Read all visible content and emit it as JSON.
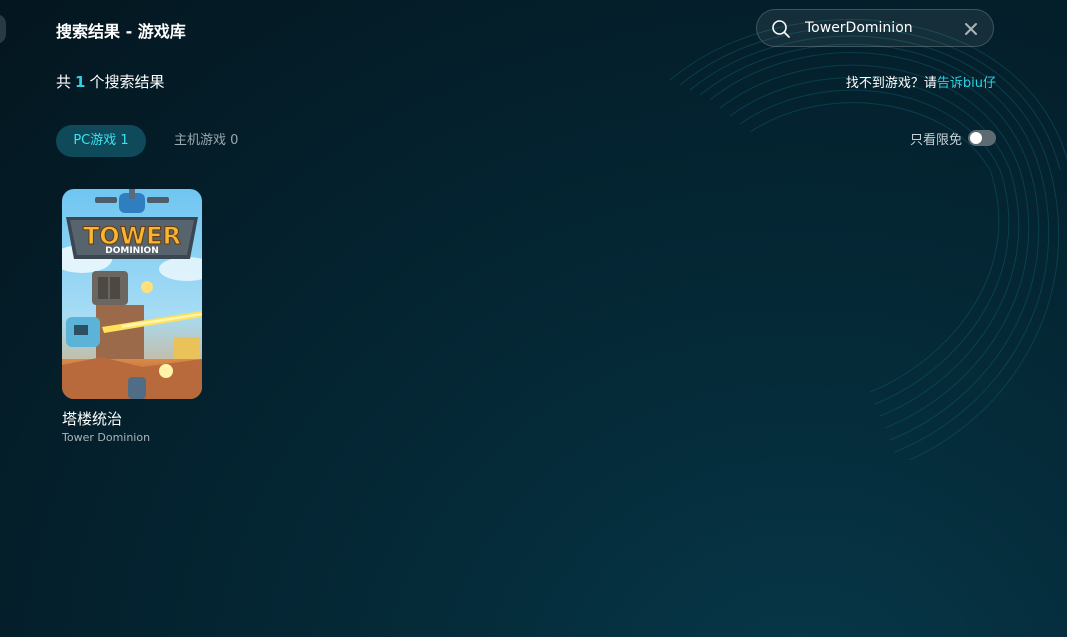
{
  "header": {
    "title": "搜索结果 - 游戏库"
  },
  "search": {
    "value": "TowerDominion",
    "icon": "search-icon",
    "clear_icon": "close-icon"
  },
  "results": {
    "prefix": "共",
    "count": "1",
    "suffix": "个搜索结果"
  },
  "help": {
    "text": "找不到游戏？请",
    "link": "告诉biu仔"
  },
  "tabs": [
    {
      "label": "PC游戏 1",
      "active": true
    },
    {
      "label": "主机游戏 0",
      "active": false
    }
  ],
  "filter": {
    "label": "只看限免",
    "enabled": false
  },
  "games": [
    {
      "title_cn": "塔楼统治",
      "title_en": "Tower Dominion",
      "cover_title_line1": "TOWER",
      "cover_title_line2": "DOMINION"
    }
  ],
  "colors": {
    "accent": "#2ad3e6",
    "tab_active_bg": "#0e4a5a",
    "background": "#041f2b"
  }
}
